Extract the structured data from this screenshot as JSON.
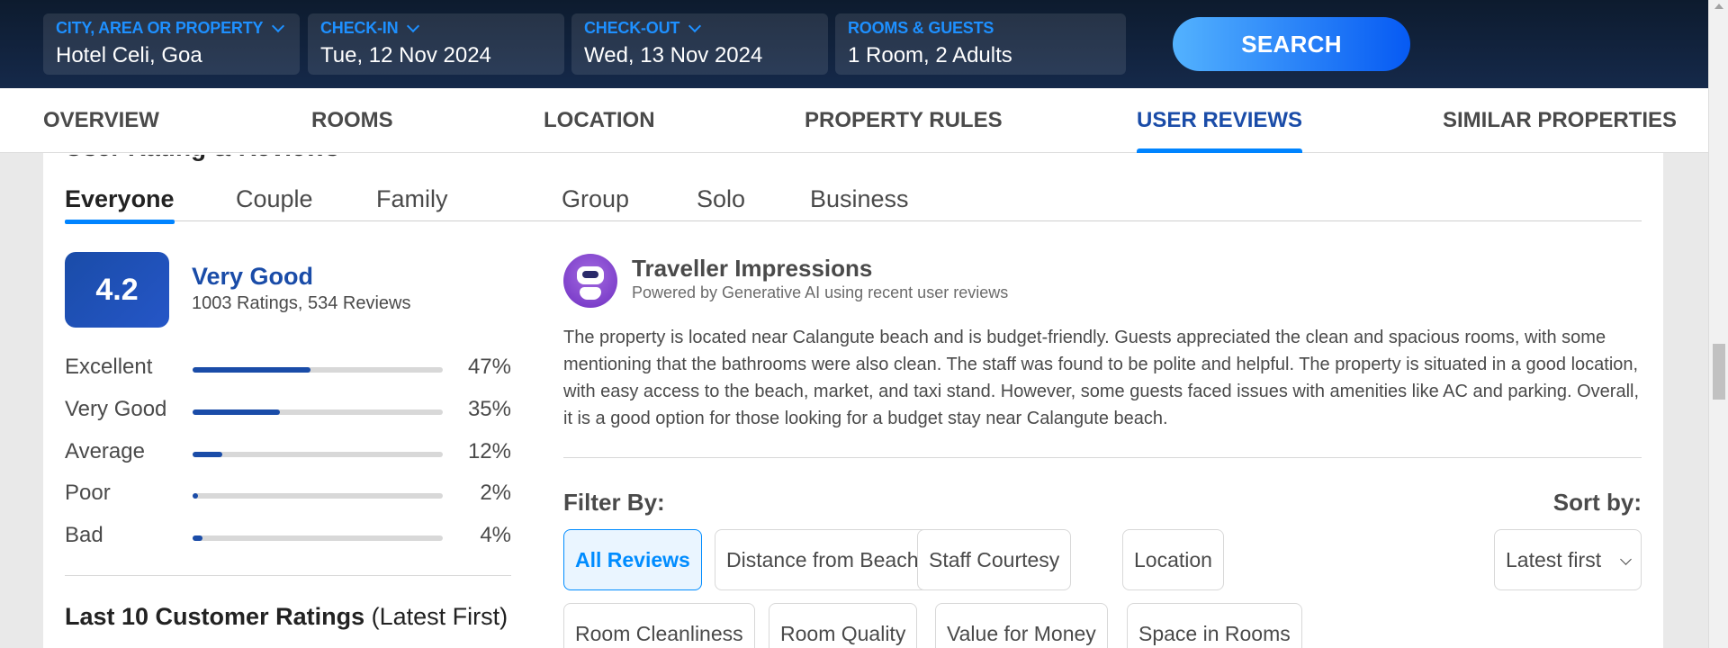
{
  "search": {
    "fields": [
      {
        "label": "CITY, AREA OR PROPERTY",
        "value": "Hotel Celi, Goa"
      },
      {
        "label": "CHECK-IN",
        "value": "Tue, 12 Nov 2024"
      },
      {
        "label": "CHECK-OUT",
        "value": "Wed, 13 Nov 2024"
      },
      {
        "label": "ROOMS & GUESTS",
        "value": "1 Room, 2 Adults"
      }
    ],
    "button_label": "SEARCH"
  },
  "nav": {
    "tabs": [
      "OVERVIEW",
      "ROOMS",
      "LOCATION",
      "PROPERTY RULES",
      "USER REVIEWS",
      "SIMILAR PROPERTIES"
    ],
    "active": "USER REVIEWS"
  },
  "reviews": {
    "title": "User Rating & Reviews",
    "segments": [
      "Everyone",
      "Couple",
      "Family",
      "Group",
      "Solo",
      "Business"
    ],
    "active_segment": "Everyone",
    "score": "4.2",
    "score_label": "Very Good",
    "score_count": "1003 Ratings, 534 Reviews",
    "breakdown": [
      {
        "label": "Excellent",
        "percent": 47,
        "display": "47%"
      },
      {
        "label": "Very Good",
        "percent": 35,
        "display": "35%"
      },
      {
        "label": "Average",
        "percent": 12,
        "display": "12%"
      },
      {
        "label": "Poor",
        "percent": 2,
        "display": "2%"
      },
      {
        "label": "Bad",
        "percent": 4,
        "display": "4%"
      }
    ],
    "last10_bold": "Last 10 Customer Ratings",
    "last10_rest": " (Latest First)"
  },
  "impressions": {
    "icon": "robot-icon",
    "title": "Traveller Impressions",
    "subtitle": "Powered by Generative AI using recent user reviews",
    "text": "The property is located near Calangute beach and is budget-friendly. Guests appreciated the clean and spacious rooms, with some mentioning that the bathrooms were also clean. The staff was found to be polite and helpful. The property is situated in a good location, with easy access to the beach, market, and taxi stand. However, some guests faced issues with amenities like AC and parking. Overall, it is a good option for those looking for a budget stay near Calangute beach."
  },
  "filters": {
    "label": "Filter By:",
    "chips": [
      "All Reviews",
      "Distance from Beach",
      "Staff Courtesy",
      "Location",
      "Room Cleanliness",
      "Room Quality",
      "Value for Money",
      "Space in Rooms"
    ],
    "active": "All Reviews"
  },
  "sort": {
    "label": "Sort by:",
    "selected": "Latest first"
  },
  "colors": {
    "accent_blue": "#0084ff",
    "brand_navy": "#1a4ca8",
    "header_bg": "#0d1b2e"
  }
}
